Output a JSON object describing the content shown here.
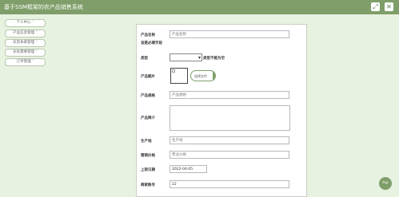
{
  "app": {
    "title": "基于SSM框架的农产品销售系统"
  },
  "header_icons": {
    "fullscreen": "⤢",
    "close": "✕"
  },
  "sidebar": {
    "items": [
      {
        "label": "个人中心 ˅"
      },
      {
        "label": "产品信息管理 ˅"
      },
      {
        "label": "农贸本来管理 ˅"
      },
      {
        "label": "农民需要管理 ˅"
      },
      {
        "label": "订单管理 ˅"
      }
    ]
  },
  "form": {
    "product_name": {
      "label": "产品名称",
      "placeholder": "产品名称"
    },
    "required_hint": "该是必填字段",
    "category": {
      "label": "类型",
      "hint": "类型不能为空"
    },
    "image": {
      "label": "产品图片",
      "upload_label": "选择文件"
    },
    "spec": {
      "label": "产品规格",
      "placeholder": "产品规格"
    },
    "intro": {
      "label": "产品简介"
    },
    "origin": {
      "label": "生产地",
      "placeholder": "生产地"
    },
    "price": {
      "label": "营销价格",
      "placeholder": "营业价格"
    },
    "date": {
      "label": "上架日期",
      "value": "2022-04-05"
    },
    "merchant": {
      "label": "商家账号",
      "value": "22"
    }
  },
  "fab": {
    "label": "top"
  }
}
